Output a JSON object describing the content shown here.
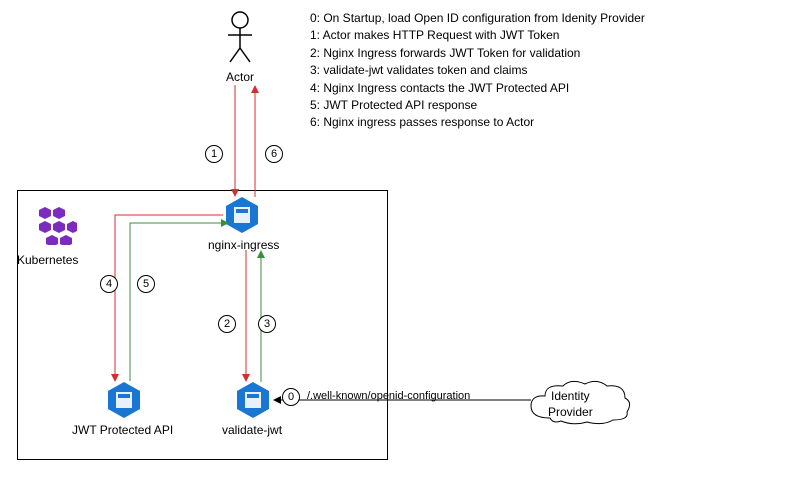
{
  "actor": {
    "label": "Actor"
  },
  "k8s": {
    "label": "Kubernetes"
  },
  "nodes": {
    "nginx": "nginx-ingress",
    "jwt_api": "JWT Protected API",
    "validate": "validate-jwt",
    "idp_line1": "Identity",
    "idp_line2": "Provider"
  },
  "protocol": "/.well-known/openid-configuration",
  "badges": {
    "b0": "0",
    "b1": "1",
    "b2": "2",
    "b3": "3",
    "b4": "4",
    "b5": "5",
    "b6": "6"
  },
  "steps": {
    "s0": "0: On Startup, load Open ID configuration from Idenity Provider",
    "s1": "1: Actor makes HTTP Request with JWT Token",
    "s2": "2: Nginx Ingress forwards JWT Token for validation",
    "s3": "3: validate-jwt validates token and claims",
    "s4": "4: Nginx Ingress contacts the JWT Protected API",
    "s5": "5: JWT Protected API response",
    "s6": "6: Nginx ingress passes response to Actor"
  }
}
